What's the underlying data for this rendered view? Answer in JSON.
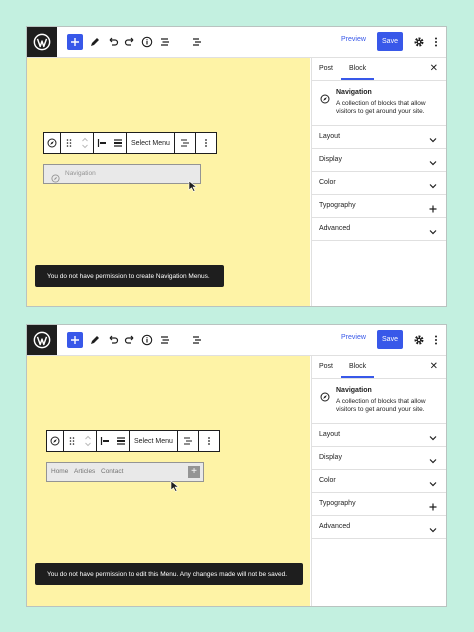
{
  "screens": [
    {
      "toolbar": {
        "preview_label": "Preview",
        "save_label": "Save"
      },
      "sidebar": {
        "tabs": [
          {
            "label": "Post"
          },
          {
            "label": "Block"
          }
        ],
        "active_tab": "Block",
        "block_title": "Navigation",
        "block_desc": "A collection of blocks that allow visitors to get around your site.",
        "panels": [
          {
            "label": "Layout",
            "icon": "chevron-down-icon"
          },
          {
            "label": "Display",
            "icon": "chevron-down-icon"
          },
          {
            "label": "Color",
            "icon": "chevron-down-icon"
          },
          {
            "label": "Typography",
            "icon": "plus-icon"
          },
          {
            "label": "Advanced",
            "icon": "chevron-down-icon"
          }
        ]
      },
      "block_toolbar": {
        "select_menu_label": "Select Menu"
      },
      "navigation_placeholder": "Navigation",
      "notice": "You do not have permission to create Navigation Menus."
    },
    {
      "toolbar": {
        "preview_label": "Preview",
        "save_label": "Save"
      },
      "sidebar": {
        "tabs": [
          {
            "label": "Post"
          },
          {
            "label": "Block"
          }
        ],
        "active_tab": "Block",
        "block_title": "Navigation",
        "block_desc": "A collection of blocks that allow visitors to get around your site.",
        "panels": [
          {
            "label": "Layout",
            "icon": "chevron-down-icon"
          },
          {
            "label": "Display",
            "icon": "chevron-down-icon"
          },
          {
            "label": "Color",
            "icon": "chevron-down-icon"
          },
          {
            "label": "Typography",
            "icon": "plus-icon"
          },
          {
            "label": "Advanced",
            "icon": "chevron-down-icon"
          }
        ]
      },
      "block_toolbar": {
        "select_menu_label": "Select Menu"
      },
      "navigation_items": [
        "Home",
        "Articles",
        "Contact"
      ],
      "notice": "You do not have permission to edit this Menu. Any changes made will not be saved."
    }
  ],
  "colors": {
    "accent": "#3858e9",
    "canvas": "#fef3a6",
    "background": "#c3f0e0",
    "notice_bg": "#1e1e1e"
  }
}
